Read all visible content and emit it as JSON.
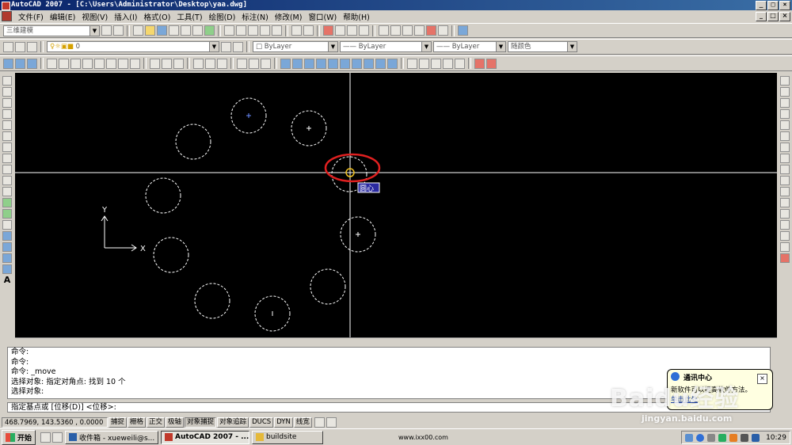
{
  "window": {
    "title": "AutoCAD 2007 - [C:\\Users\\Administrator\\Desktop\\yaa.dwg]"
  },
  "menu": [
    "文件(F)",
    "编辑(E)",
    "视图(V)",
    "插入(I)",
    "格式(O)",
    "工具(T)",
    "绘图(D)",
    "标注(N)",
    "修改(M)",
    "窗口(W)",
    "帮助(H)"
  ],
  "toolbars": {
    "workspace": "三维建模",
    "layer": "0",
    "color": "ByLayer",
    "linetype": "ByLayer",
    "lineweight": "ByLayer",
    "plotstyle": "随颜色"
  },
  "canvas": {
    "snap_tooltip": "圆心",
    "ucs_x_label": "X",
    "ucs_y_label": "Y",
    "background": "#000000",
    "highlight_color": "#e02020",
    "tooltip_bg": "#2a2aa0"
  },
  "command_history": [
    "命令:",
    "命令:",
    "命令:  _move",
    "选择对象: 指定对角点: 找到 10 个",
    "选择对象:"
  ],
  "command_prompt": "指定基点或 [位移(D)] <位移>:",
  "status": {
    "coords": "468.7969, 143.5360 , 0.0000",
    "buttons": [
      {
        "label": "捕捉",
        "on": false
      },
      {
        "label": "栅格",
        "on": false
      },
      {
        "label": "正交",
        "on": false
      },
      {
        "label": "极轴",
        "on": false
      },
      {
        "label": "对象捕捉",
        "on": true
      },
      {
        "label": "对象追踪",
        "on": false
      },
      {
        "label": "DUCS",
        "on": false
      },
      {
        "label": "DYN",
        "on": false
      },
      {
        "label": "线宽",
        "on": false
      }
    ]
  },
  "balloon": {
    "title": "通讯中心",
    "text": "新软件可以提高软件方法。",
    "link": "单击此处"
  },
  "taskbar": {
    "start": "开始",
    "tasks": [
      {
        "label": "收件箱 - xueweili@s...",
        "active": false
      },
      {
        "label": "AutoCAD 2007 - ...",
        "active": true
      },
      {
        "label": "buildsite",
        "active": false
      }
    ],
    "url_text": "www.ixx00.com",
    "clock": "10:29"
  },
  "watermark": {
    "logo": "Baidu经验",
    "url": "jingyan.baidu.com"
  }
}
